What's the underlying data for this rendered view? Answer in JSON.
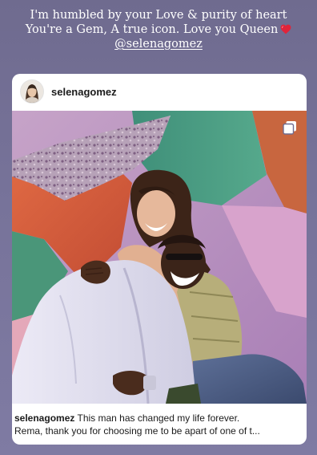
{
  "story": {
    "caption_line1": "I'm humbled by your Love & purity of heart",
    "caption_line2": "You're a Gem, A true icon. Love you Queen",
    "heart_icon": "heart-emoji",
    "mention": "@selenagomez"
  },
  "post": {
    "username": "selenagomez",
    "avatar_icon": "profile-avatar",
    "media_icon": "multiple-photos-icon",
    "caption_user": "selenagomez",
    "caption_line1": "This man has changed my life forever.",
    "caption_line2": "Rema, thank you for choosing me to be apart of one of t..."
  }
}
